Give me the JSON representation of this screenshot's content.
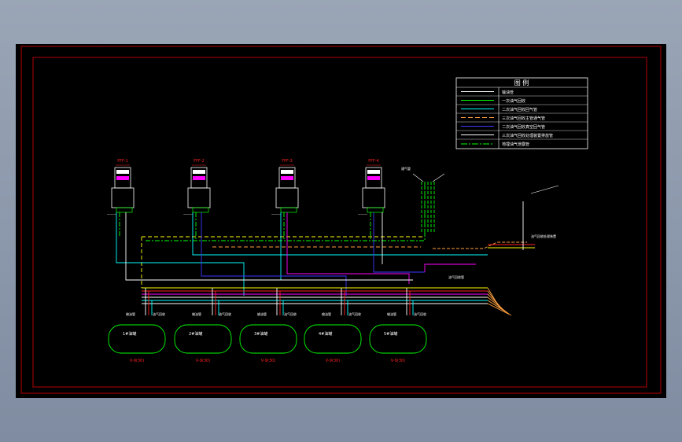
{
  "colors": {
    "frame": "#b40000",
    "white": "#ffffff",
    "green": "#00ff00",
    "cyan": "#00ffff",
    "yellow": "#ffff00",
    "magenta": "#ff00ff",
    "blue": "#3a3aff",
    "orange": "#ffa040",
    "red": "#ff2020",
    "lightgreen": "#b8ffb8"
  },
  "legend": {
    "title": "图    例",
    "entries": [
      {
        "label": "输油管",
        "line_color": "#ffffff",
        "style": "solid",
        "icon": "line-solid-white"
      },
      {
        "label": "一次油气回收",
        "line_color": "#00ff00",
        "style": "solid",
        "icon": "line-solid-green"
      },
      {
        "label": "二次油气回收回气管",
        "line_color": "#00ffff",
        "style": "solid",
        "icon": "line-solid-cyan"
      },
      {
        "label": "三次油气回收主管通气管",
        "line_color": "#ffa040",
        "style": "dashed",
        "icon": "line-dashed-orange"
      },
      {
        "label": "二次油气回收真空回气管",
        "line_color": "#3a3aff",
        "style": "solid",
        "icon": "line-solid-blue"
      },
      {
        "label": "三次油气回收处理装置排放管",
        "line_color": "#ffffff",
        "style": "solid",
        "icon": "line-solid-white"
      },
      {
        "label": "地埋油气泄露管",
        "line_color": "#00ff00",
        "style": "dashdot",
        "icon": "line-dashdot-green"
      }
    ]
  },
  "dispensers": [
    {
      "label": "FFF-1"
    },
    {
      "label": "FFF-2"
    },
    {
      "label": "FFF-3"
    },
    {
      "label": "FFF-4"
    }
  ],
  "tanks": [
    {
      "inner_label": "1#油罐",
      "code": "V-9(30)"
    },
    {
      "inner_label": "2#油罐",
      "code": "V-9(30)"
    },
    {
      "inner_label": "3#油罐",
      "code": "V-9(30)"
    },
    {
      "inner_label": "4#油罐",
      "code": "V-9(30)"
    },
    {
      "inner_label": "5#油罐",
      "code": "V-9(30)"
    }
  ],
  "tank_note_left": "输油管",
  "tank_note_right": "油气回收",
  "vent_label": "通气管",
  "processor_label": "油气回收处理装置",
  "pipe_label": "油气回收管"
}
